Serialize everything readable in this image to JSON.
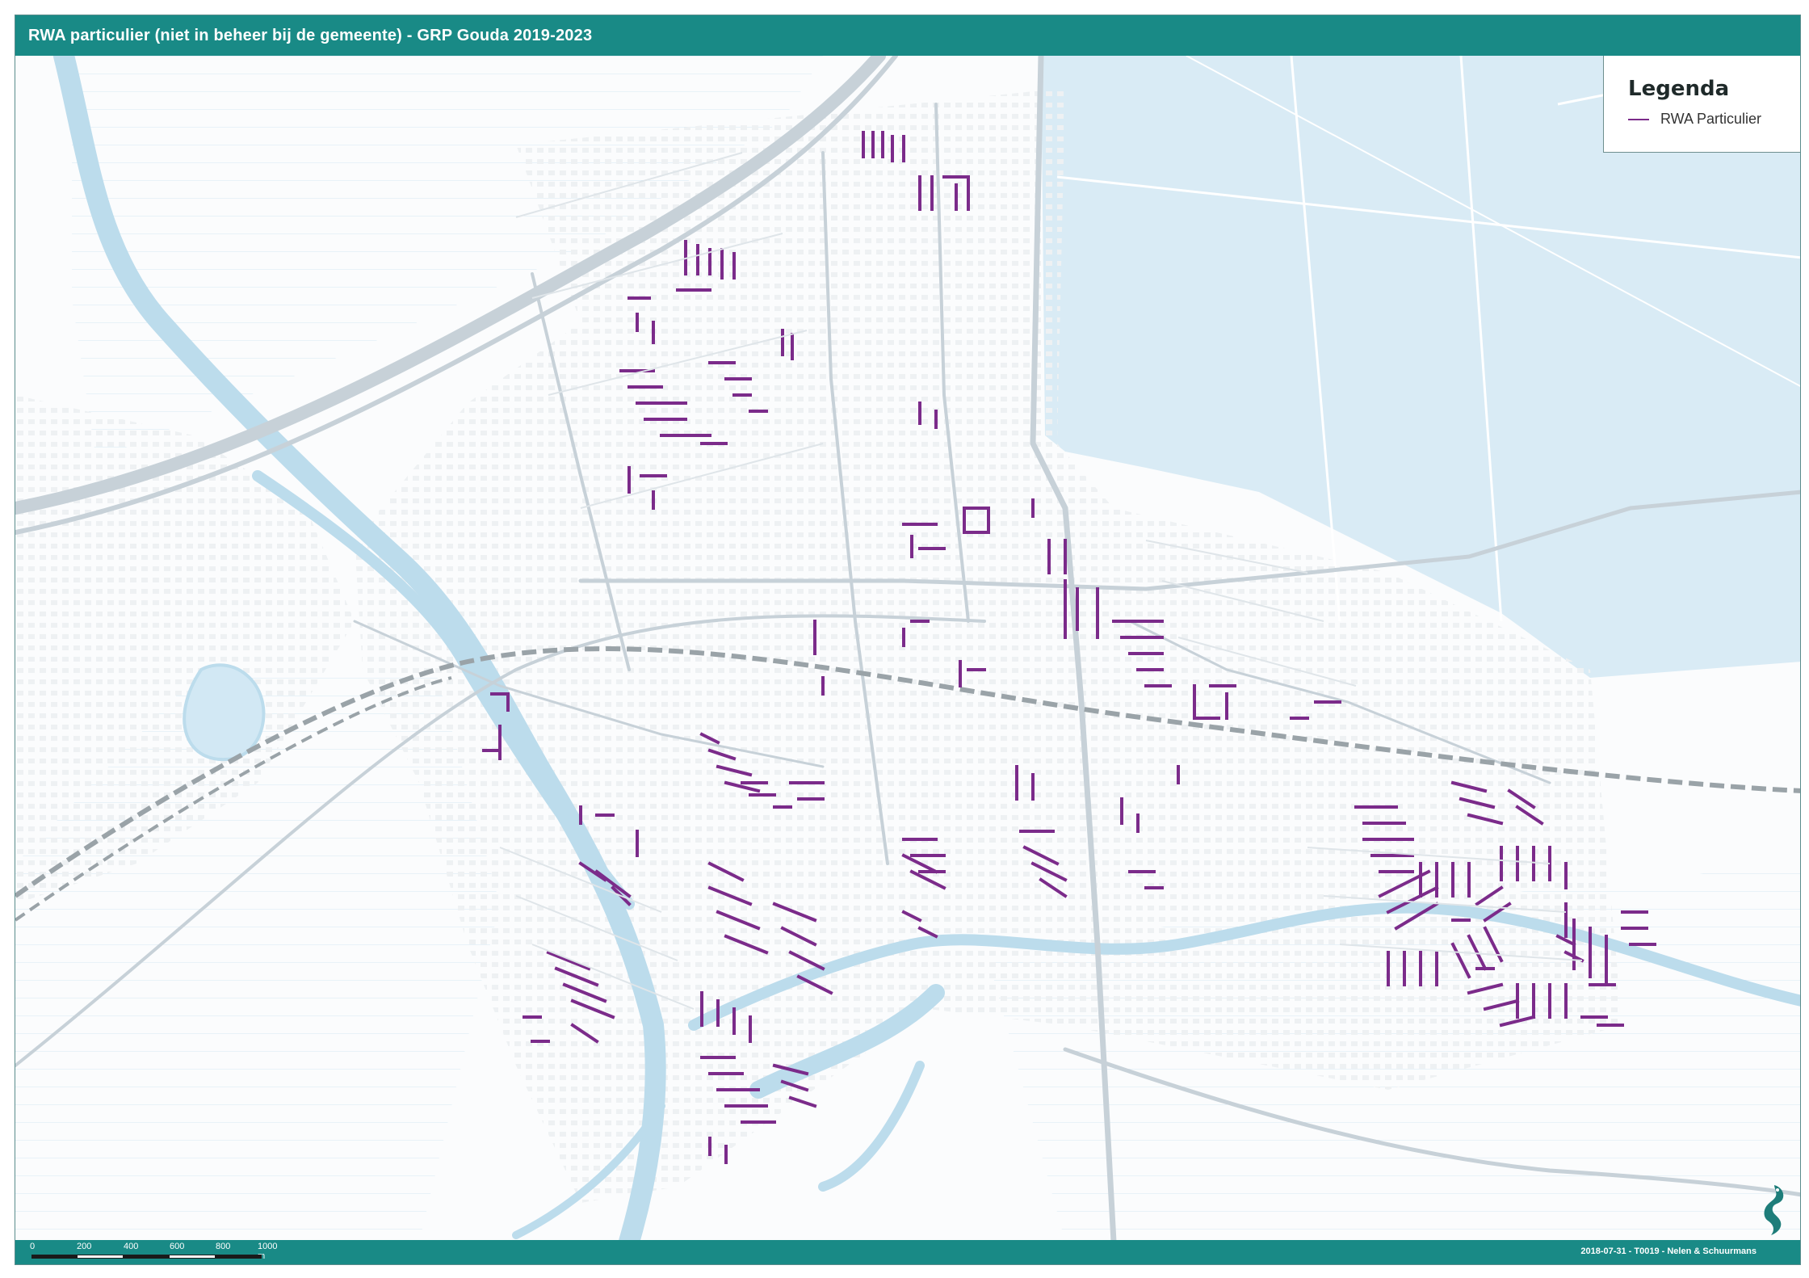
{
  "title": "RWA particulier (niet in beheer bij de gemeente) - GRP Gouda 2019-2023",
  "legend": {
    "title": "Legenda",
    "items": [
      {
        "label": "RWA Particulier",
        "color": "#7b2b8a"
      }
    ]
  },
  "scale": {
    "labels": [
      "0",
      "200",
      "400",
      "600",
      "800",
      "1000 m"
    ]
  },
  "footer": {
    "credit": "2018-07-31 - T0019 - Nelen & Schuurmans"
  },
  "colors": {
    "header": "#198a86",
    "water": "#cfe6f2",
    "rwa": "#7b2b8a",
    "road": "#c9d4db"
  },
  "icons": [
    "logo-icon"
  ]
}
